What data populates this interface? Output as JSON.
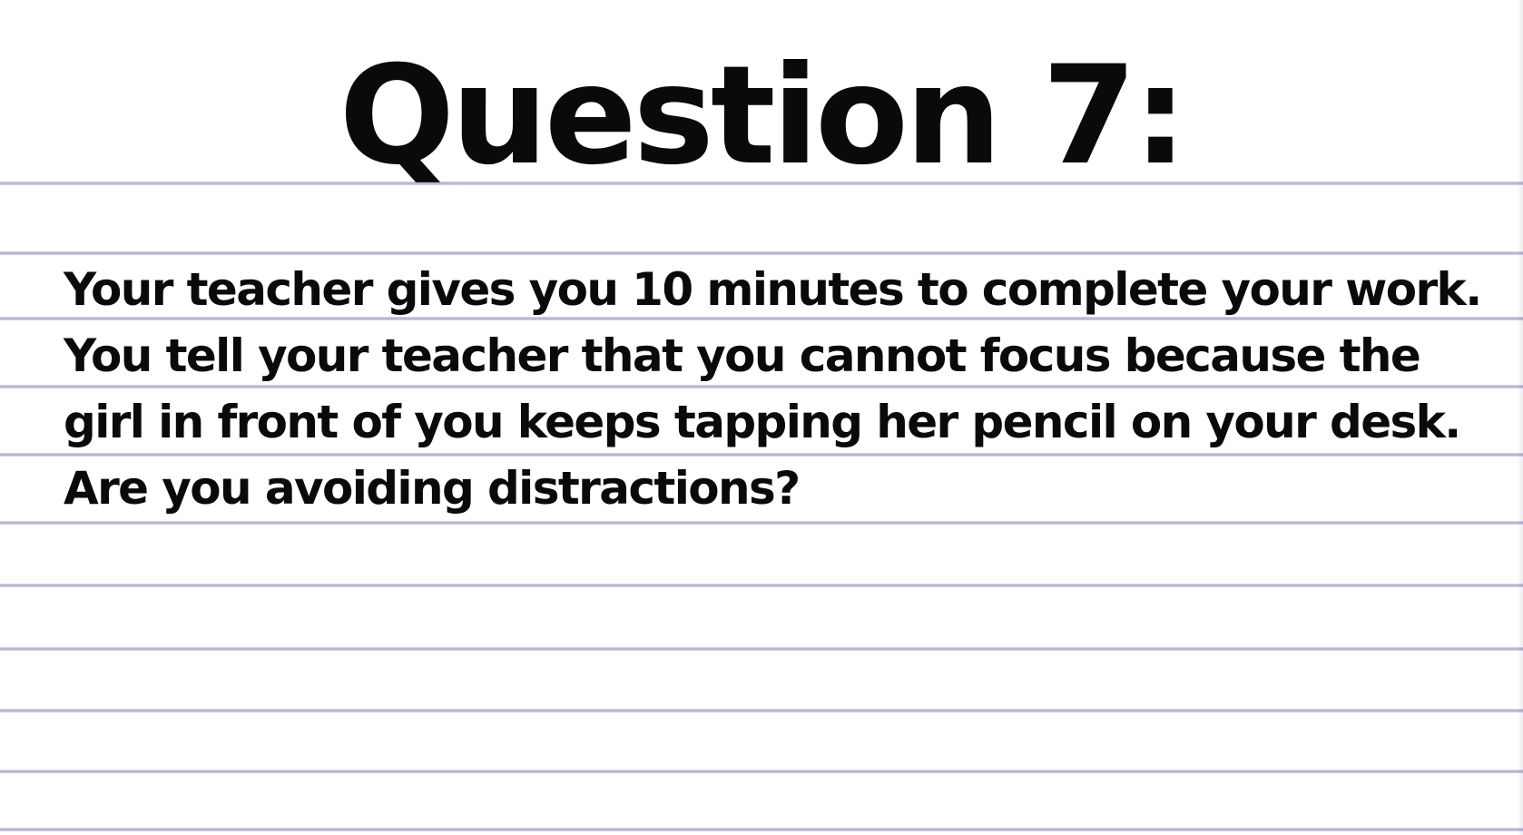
{
  "title": "Question 7:",
  "question_lines": [
    "Your teacher gives you 10 minutes to complete your work.",
    "You tell your teacher that you cannot focus because the",
    "girl in front of you keeps tapping her pencil on your desk.",
    "Are you avoiding distractions?"
  ],
  "colors": {
    "paper": "#ffffff",
    "ruled_line": "#a9abd6",
    "text": "#0a0a0a"
  }
}
